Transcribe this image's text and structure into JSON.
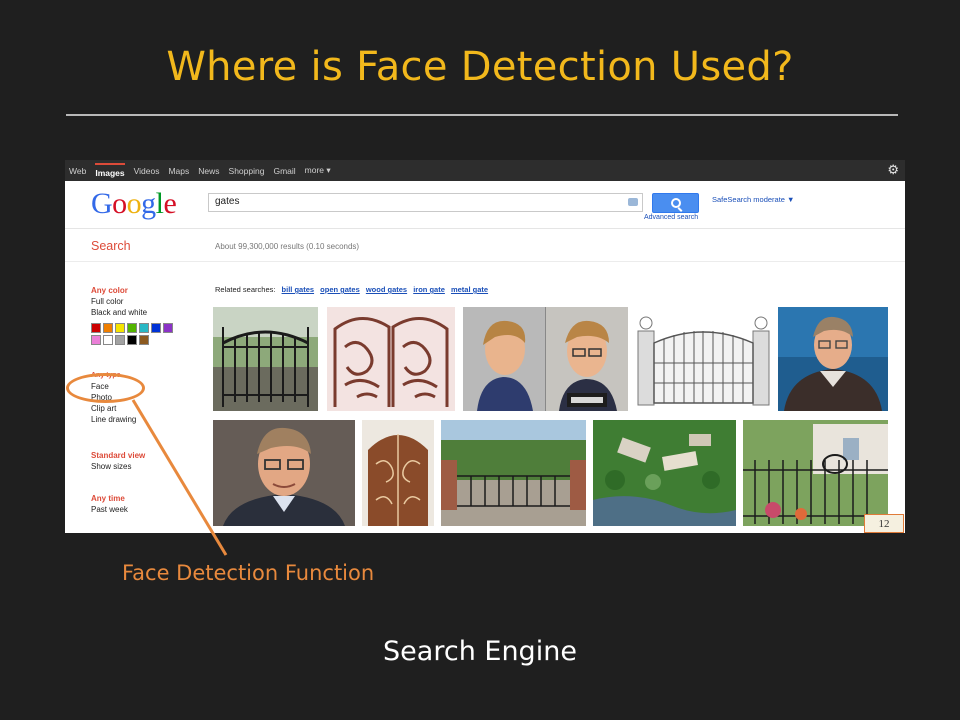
{
  "slide": {
    "title": "Where is Face Detection Used?",
    "callout_label": "Face Detection Function",
    "caption": "Search Engine",
    "slide_number": "12",
    "accent_color": "#f2b81c",
    "callout_color": "#e8893d"
  },
  "google": {
    "nav": [
      "Web",
      "Images",
      "Videos",
      "Maps",
      "News",
      "Shopping",
      "Gmail",
      "more ▾"
    ],
    "active_nav": "Images",
    "logo_letters": [
      "G",
      "o",
      "o",
      "g",
      "l",
      "e"
    ],
    "search_query": "gates",
    "advanced_search": "Advanced search",
    "safesearch": "SafeSearch moderate ▼",
    "search_label": "Search",
    "result_stats": "About 99,300,000 results (0.10 seconds)",
    "related_label": "Related searches:",
    "related": [
      "bill gates",
      "open gates",
      "wood gates",
      "iron gate",
      "metal gate"
    ],
    "color_filter": {
      "heading": "Any color",
      "options": [
        "Full color",
        "Black and white"
      ],
      "swatches": [
        "#cc0000",
        "#f07f00",
        "#f5e400",
        "#53b400",
        "#29b8c5",
        "#0032d6",
        "#8b33c7",
        "#ea7fd7",
        "#ffffff",
        "#a2a2a2",
        "#000000",
        "#8c5a1f"
      ]
    },
    "type_filter": {
      "heading": "Any type",
      "options": [
        "Face",
        "Photo",
        "Clip art",
        "Line drawing"
      ]
    },
    "view_filter": {
      "heading": "Standard view",
      "options": [
        "Show sizes"
      ]
    },
    "time_filter": {
      "heading": "Any time",
      "options": [
        "Past week"
      ]
    }
  }
}
